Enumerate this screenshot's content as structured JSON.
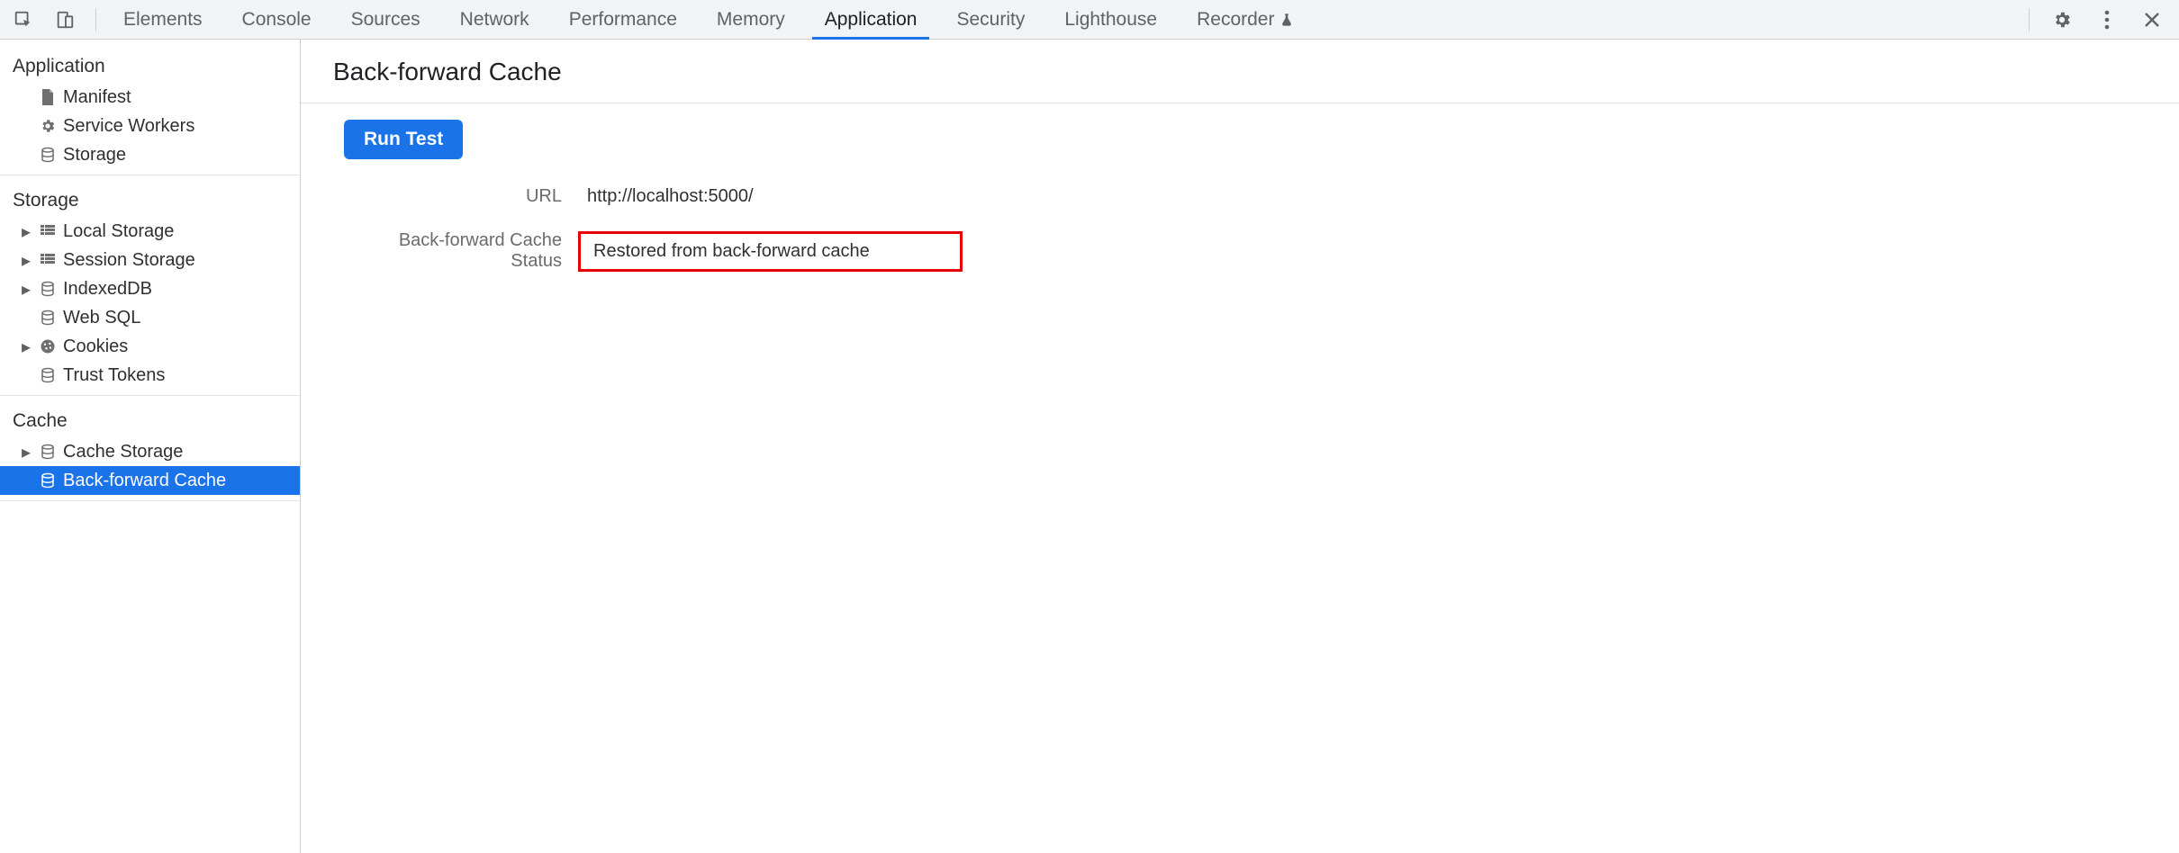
{
  "tabs": [
    {
      "id": "elements",
      "label": "Elements"
    },
    {
      "id": "console",
      "label": "Console"
    },
    {
      "id": "sources",
      "label": "Sources"
    },
    {
      "id": "network",
      "label": "Network"
    },
    {
      "id": "performance",
      "label": "Performance"
    },
    {
      "id": "memory",
      "label": "Memory"
    },
    {
      "id": "application",
      "label": "Application",
      "active": true
    },
    {
      "id": "security",
      "label": "Security"
    },
    {
      "id": "lighthouse",
      "label": "Lighthouse"
    },
    {
      "id": "recorder",
      "label": "Recorder",
      "flask": true
    }
  ],
  "sidebar": {
    "application": {
      "title": "Application",
      "items": [
        {
          "id": "manifest",
          "label": "Manifest",
          "icon": "file"
        },
        {
          "id": "service-workers",
          "label": "Service Workers",
          "icon": "gear"
        },
        {
          "id": "storage",
          "label": "Storage",
          "icon": "db"
        }
      ]
    },
    "storage": {
      "title": "Storage",
      "items": [
        {
          "id": "local-storage",
          "label": "Local Storage",
          "icon": "grid",
          "expandable": true
        },
        {
          "id": "session-storage",
          "label": "Session Storage",
          "icon": "grid",
          "expandable": true
        },
        {
          "id": "indexeddb",
          "label": "IndexedDB",
          "icon": "db",
          "expandable": true
        },
        {
          "id": "web-sql",
          "label": "Web SQL",
          "icon": "db"
        },
        {
          "id": "cookies",
          "label": "Cookies",
          "icon": "cookie",
          "expandable": true
        },
        {
          "id": "trust-tokens",
          "label": "Trust Tokens",
          "icon": "db"
        }
      ]
    },
    "cache": {
      "title": "Cache",
      "items": [
        {
          "id": "cache-storage",
          "label": "Cache Storage",
          "icon": "db",
          "expandable": true
        },
        {
          "id": "back-forward-cache",
          "label": "Back-forward Cache",
          "icon": "db",
          "selected": true
        }
      ]
    }
  },
  "content": {
    "title": "Back-forward Cache",
    "run_button": "Run Test",
    "rows": [
      {
        "label": "URL",
        "value": "http://localhost:5000/"
      },
      {
        "label": "Back-forward Cache Status",
        "value": "Restored from back-forward cache",
        "highlight": true
      }
    ]
  }
}
